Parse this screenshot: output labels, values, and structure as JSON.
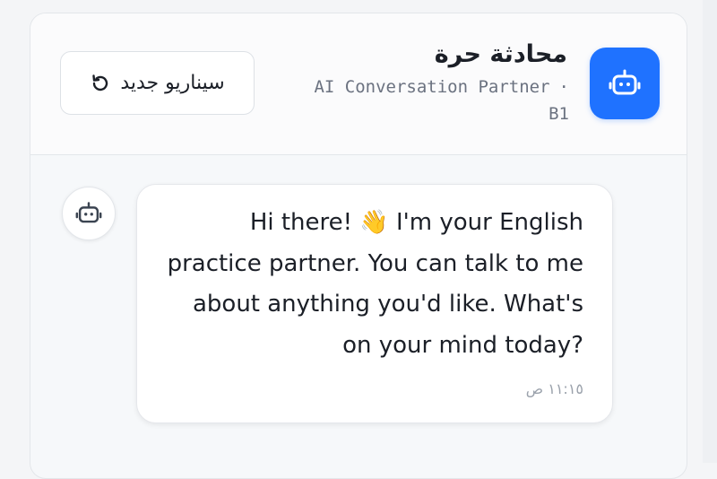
{
  "header": {
    "title": "محادثة حرة",
    "subtitle": "AI Conversation Partner",
    "separator": "·",
    "level": "B1",
    "new_scenario_label": "سيناريو جديد"
  },
  "icons": {
    "main_avatar": "robot-icon",
    "new_scenario": "refresh-icon",
    "message_avatar": "robot-icon"
  },
  "message": {
    "text": "Hi there! 👋 I'm your English practice partner. You can talk to me about anything you'd like. What's on your mind today?",
    "time": "١١:١٥ ص"
  },
  "colors": {
    "accent": "#1f72ff",
    "text": "#1b1f27",
    "muted": "#6b7280"
  }
}
